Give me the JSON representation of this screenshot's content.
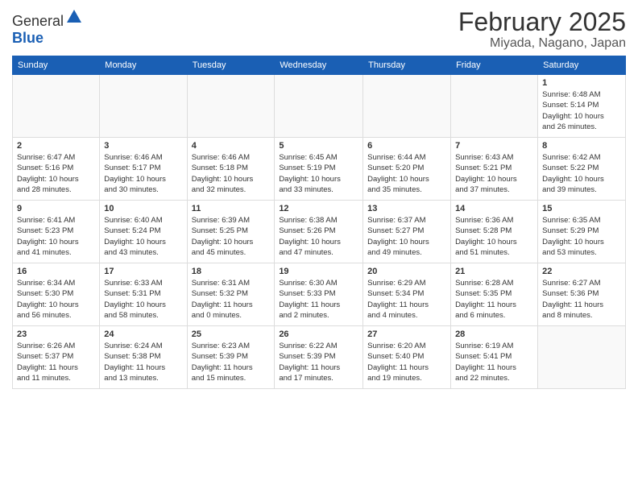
{
  "header": {
    "logo_general": "General",
    "logo_blue": "Blue",
    "month": "February 2025",
    "location": "Miyada, Nagano, Japan"
  },
  "weekdays": [
    "Sunday",
    "Monday",
    "Tuesday",
    "Wednesday",
    "Thursday",
    "Friday",
    "Saturday"
  ],
  "weeks": [
    [
      {
        "day": "",
        "info": ""
      },
      {
        "day": "",
        "info": ""
      },
      {
        "day": "",
        "info": ""
      },
      {
        "day": "",
        "info": ""
      },
      {
        "day": "",
        "info": ""
      },
      {
        "day": "",
        "info": ""
      },
      {
        "day": "1",
        "info": "Sunrise: 6:48 AM\nSunset: 5:14 PM\nDaylight: 10 hours\nand 26 minutes."
      }
    ],
    [
      {
        "day": "2",
        "info": "Sunrise: 6:47 AM\nSunset: 5:16 PM\nDaylight: 10 hours\nand 28 minutes."
      },
      {
        "day": "3",
        "info": "Sunrise: 6:46 AM\nSunset: 5:17 PM\nDaylight: 10 hours\nand 30 minutes."
      },
      {
        "day": "4",
        "info": "Sunrise: 6:46 AM\nSunset: 5:18 PM\nDaylight: 10 hours\nand 32 minutes."
      },
      {
        "day": "5",
        "info": "Sunrise: 6:45 AM\nSunset: 5:19 PM\nDaylight: 10 hours\nand 33 minutes."
      },
      {
        "day": "6",
        "info": "Sunrise: 6:44 AM\nSunset: 5:20 PM\nDaylight: 10 hours\nand 35 minutes."
      },
      {
        "day": "7",
        "info": "Sunrise: 6:43 AM\nSunset: 5:21 PM\nDaylight: 10 hours\nand 37 minutes."
      },
      {
        "day": "8",
        "info": "Sunrise: 6:42 AM\nSunset: 5:22 PM\nDaylight: 10 hours\nand 39 minutes."
      }
    ],
    [
      {
        "day": "9",
        "info": "Sunrise: 6:41 AM\nSunset: 5:23 PM\nDaylight: 10 hours\nand 41 minutes."
      },
      {
        "day": "10",
        "info": "Sunrise: 6:40 AM\nSunset: 5:24 PM\nDaylight: 10 hours\nand 43 minutes."
      },
      {
        "day": "11",
        "info": "Sunrise: 6:39 AM\nSunset: 5:25 PM\nDaylight: 10 hours\nand 45 minutes."
      },
      {
        "day": "12",
        "info": "Sunrise: 6:38 AM\nSunset: 5:26 PM\nDaylight: 10 hours\nand 47 minutes."
      },
      {
        "day": "13",
        "info": "Sunrise: 6:37 AM\nSunset: 5:27 PM\nDaylight: 10 hours\nand 49 minutes."
      },
      {
        "day": "14",
        "info": "Sunrise: 6:36 AM\nSunset: 5:28 PM\nDaylight: 10 hours\nand 51 minutes."
      },
      {
        "day": "15",
        "info": "Sunrise: 6:35 AM\nSunset: 5:29 PM\nDaylight: 10 hours\nand 53 minutes."
      }
    ],
    [
      {
        "day": "16",
        "info": "Sunrise: 6:34 AM\nSunset: 5:30 PM\nDaylight: 10 hours\nand 56 minutes."
      },
      {
        "day": "17",
        "info": "Sunrise: 6:33 AM\nSunset: 5:31 PM\nDaylight: 10 hours\nand 58 minutes."
      },
      {
        "day": "18",
        "info": "Sunrise: 6:31 AM\nSunset: 5:32 PM\nDaylight: 11 hours\nand 0 minutes."
      },
      {
        "day": "19",
        "info": "Sunrise: 6:30 AM\nSunset: 5:33 PM\nDaylight: 11 hours\nand 2 minutes."
      },
      {
        "day": "20",
        "info": "Sunrise: 6:29 AM\nSunset: 5:34 PM\nDaylight: 11 hours\nand 4 minutes."
      },
      {
        "day": "21",
        "info": "Sunrise: 6:28 AM\nSunset: 5:35 PM\nDaylight: 11 hours\nand 6 minutes."
      },
      {
        "day": "22",
        "info": "Sunrise: 6:27 AM\nSunset: 5:36 PM\nDaylight: 11 hours\nand 8 minutes."
      }
    ],
    [
      {
        "day": "23",
        "info": "Sunrise: 6:26 AM\nSunset: 5:37 PM\nDaylight: 11 hours\nand 11 minutes."
      },
      {
        "day": "24",
        "info": "Sunrise: 6:24 AM\nSunset: 5:38 PM\nDaylight: 11 hours\nand 13 minutes."
      },
      {
        "day": "25",
        "info": "Sunrise: 6:23 AM\nSunset: 5:39 PM\nDaylight: 11 hours\nand 15 minutes."
      },
      {
        "day": "26",
        "info": "Sunrise: 6:22 AM\nSunset: 5:39 PM\nDaylight: 11 hours\nand 17 minutes."
      },
      {
        "day": "27",
        "info": "Sunrise: 6:20 AM\nSunset: 5:40 PM\nDaylight: 11 hours\nand 19 minutes."
      },
      {
        "day": "28",
        "info": "Sunrise: 6:19 AM\nSunset: 5:41 PM\nDaylight: 11 hours\nand 22 minutes."
      },
      {
        "day": "",
        "info": ""
      }
    ]
  ]
}
